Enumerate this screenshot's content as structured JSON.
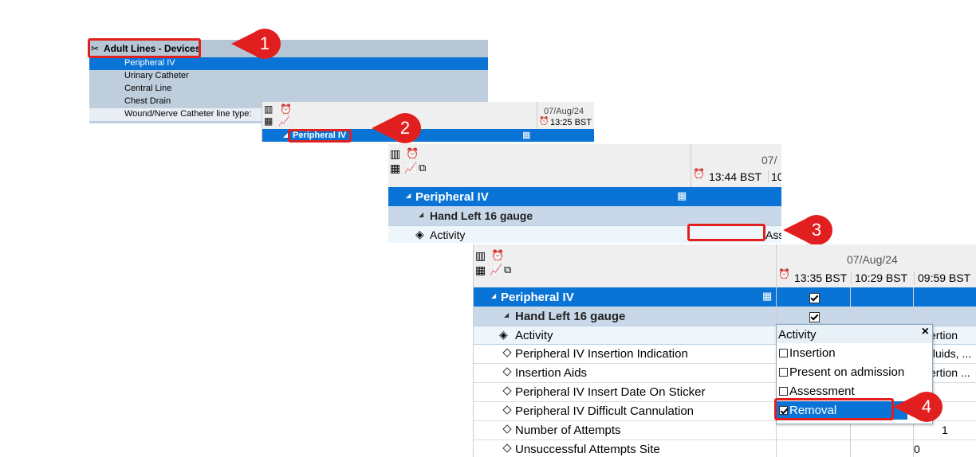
{
  "panel1": {
    "header": "Adult Lines - Devices",
    "items": [
      "Peripheral IV",
      "Urinary Catheter",
      "Central Line",
      "Chest Drain",
      "Wound/Nerve Catheter line type:"
    ]
  },
  "panel2": {
    "date": "07/Aug/24",
    "time": "13:25 BST",
    "selected": "Peripheral IV"
  },
  "panel3": {
    "date": "07/",
    "time1": "13:44 BST",
    "time2": "10",
    "section": "Peripheral IV",
    "group": "Hand Left 16 gauge",
    "activity_label": "Activity",
    "cut_value": "Ass"
  },
  "panel4": {
    "date": "07/Aug/24",
    "times": [
      "13:35 BST",
      "10:29 BST",
      "09:59 BST"
    ],
    "section": "Peripheral IV",
    "group": "Hand Left 16 gauge",
    "rows": [
      "Activity",
      "Peripheral IV Insertion Indication",
      "Insertion Aids",
      "Peripheral IV Insert Date On Sticker",
      "Peripheral IV Difficult Cannulation",
      "Number of Attempts",
      "Unsuccessful Attempts Site"
    ],
    "col3_values": [
      "ertion",
      "fluids, ...",
      "ertion ...",
      "",
      "",
      "1",
      ""
    ],
    "col2_values": [
      "",
      "",
      "",
      "",
      "",
      "",
      "0"
    ],
    "dropdown": {
      "title": "Activity",
      "options": [
        {
          "label": "Insertion",
          "checked": false
        },
        {
          "label": "Present on admission",
          "checked": false
        },
        {
          "label": "Assessment",
          "checked": false
        },
        {
          "label": "Removal",
          "checked": true
        }
      ]
    }
  },
  "callouts": [
    "1",
    "2",
    "3",
    "4"
  ],
  "colors": {
    "accent": "#0a74d6",
    "callout": "#e21f1f",
    "group": "#c9d8e8"
  }
}
